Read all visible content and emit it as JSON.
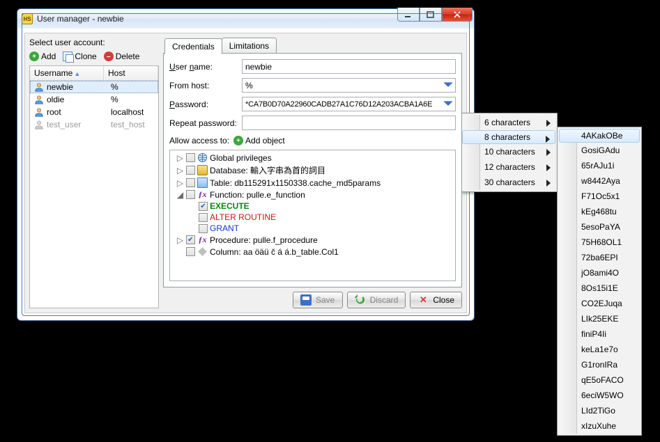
{
  "window": {
    "title": "User manager - newbie"
  },
  "left": {
    "select_label": "Select user account:",
    "add": "Add",
    "clone": "Clone",
    "delete": "Delete",
    "headers": {
      "username": "Username",
      "host": "Host"
    },
    "rows": [
      {
        "name": "newbie",
        "host": "%",
        "sel": true,
        "gray": false
      },
      {
        "name": "oldie",
        "host": "%",
        "sel": false,
        "gray": false
      },
      {
        "name": "root",
        "host": "localhost",
        "sel": false,
        "gray": false
      },
      {
        "name": "test_user",
        "host": "test_host",
        "sel": false,
        "gray": true
      }
    ]
  },
  "tabs": {
    "credentials": "Credentials",
    "limitations": "Limitations"
  },
  "form": {
    "username_label": "User name:",
    "username_value": "newbie",
    "host_label": "From host:",
    "host_value": "%",
    "password_label": "Password:",
    "password_value": "*CA7B0D70A22960CADB27A1C76D12A203ACBA1A6E",
    "repeat_label": "Repeat password:",
    "repeat_value": ""
  },
  "access": {
    "label": "Allow access to:",
    "add_object": "Add object",
    "nodes": {
      "global": "Global privileges",
      "database": "Database: 輸入字串為首的詞目",
      "table": "Table: db115291x1150338.cache_md5params",
      "function": "Function: pulle.e_function",
      "execute": "EXECUTE",
      "alter_routine": "ALTER ROUTINE",
      "grant": "GRANT",
      "procedure": "Procedure: pulle.f_procedure",
      "column": "Column: aa öäü č á á.b_table.Col1"
    }
  },
  "buttons": {
    "save": "Save",
    "discard": "Discard",
    "close": "Close"
  },
  "menu1": {
    "items": {
      "c6": "6 characters",
      "c8": "8 characters",
      "c10": "10 characters",
      "c12": "12 characters",
      "c30": "30 characters"
    }
  },
  "menu2": {
    "items": [
      "4AKakOBe",
      "GosiGAdu",
      "65rAJu1i",
      "w8442Aya",
      "F71Oc5x1",
      "kEg468tu",
      "5esoPaYA",
      "75H68OL1",
      "72ba6EPI",
      "jO8ami4O",
      "8Os15i1E",
      "CO2EJuqa",
      "LIk25EKE",
      "finiP4Ii",
      "keLa1e7o",
      "G1ronIRa",
      "qE5oFACO",
      "6eciW5WO",
      "LId2TiGo",
      "xIzuXuhe"
    ]
  }
}
